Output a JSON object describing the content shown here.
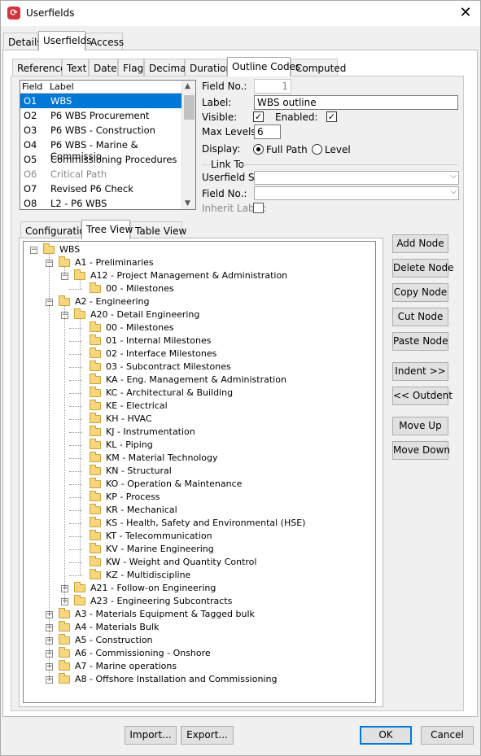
{
  "window": {
    "title": "Userfields",
    "close_glyph": "✕"
  },
  "top_tabs": [
    {
      "label": "Details"
    },
    {
      "label": "Userfields"
    },
    {
      "label": "Access"
    }
  ],
  "inner_tabs": [
    {
      "label": "Reference"
    },
    {
      "label": "Text"
    },
    {
      "label": "Date"
    },
    {
      "label": "Flag"
    },
    {
      "label": "Decimal"
    },
    {
      "label": "Duration"
    },
    {
      "label": "Outline Codes"
    },
    {
      "label": "Computed"
    }
  ],
  "field_list": {
    "headers": {
      "field": "Field",
      "label": "Label"
    },
    "rows": [
      {
        "field": "O1",
        "label": "WBS"
      },
      {
        "field": "O2",
        "label": "P6 WBS Procurement"
      },
      {
        "field": "O3",
        "label": "P6 WBS - Construction"
      },
      {
        "field": "O4",
        "label": "P6 WBS - Marine & Commissio"
      },
      {
        "field": "O5",
        "label": "Commissioning Procedures"
      },
      {
        "field": "O6",
        "label": "Critical Path"
      },
      {
        "field": "O7",
        "label": "Revised P6 Check"
      },
      {
        "field": "O8",
        "label": "L2 - P6 WBS"
      }
    ]
  },
  "props": {
    "field_no_label": "Field No.:",
    "field_no_value": "1",
    "label_label": "Label:",
    "label_value": "WBS outline",
    "visible_label": "Visible:",
    "visible_checked": "✓",
    "enabled_label": "Enabled:",
    "enabled_checked": "✓",
    "max_levels_label": "Max Levels:",
    "max_levels_value": "6",
    "display_label": "Display:",
    "full_path_label": "Full Path",
    "level_label": "Level",
    "link_to_label": "Link To",
    "userfield_set_label": "Userfield Set:",
    "field_no2_label": "Field No.:",
    "inherit_label": "Inherit Label:",
    "dropdown_glyph": "⌵"
  },
  "view_tabs": [
    {
      "label": "Configuration"
    },
    {
      "label": "Tree View"
    },
    {
      "label": "Table View"
    }
  ],
  "tree": {
    "expander_minus": "−",
    "expander_plus": "+",
    "nodes": [
      {
        "label": "WBS",
        "level": 0,
        "exp": "minus"
      },
      {
        "label": "A1 - Preliminaries",
        "level": 1,
        "exp": "minus"
      },
      {
        "label": "A12 - Project Management & Administration",
        "level": 2,
        "exp": "minus"
      },
      {
        "label": "00 - Milestones",
        "level": 3,
        "exp": ""
      },
      {
        "label": "A2 - Engineering",
        "level": 1,
        "exp": "minus"
      },
      {
        "label": "A20 - Detail Engineering",
        "level": 2,
        "exp": "minus"
      },
      {
        "label": "00 - Milestones",
        "level": 3,
        "exp": ""
      },
      {
        "label": "01 - Internal Milestones",
        "level": 3,
        "exp": ""
      },
      {
        "label": "02 - Interface Milestones",
        "level": 3,
        "exp": ""
      },
      {
        "label": "03 - Subcontract Milestones",
        "level": 3,
        "exp": ""
      },
      {
        "label": "KA - Eng. Management & Administration",
        "level": 3,
        "exp": ""
      },
      {
        "label": "KC - Architectural & Building",
        "level": 3,
        "exp": ""
      },
      {
        "label": "KE - Electrical",
        "level": 3,
        "exp": ""
      },
      {
        "label": "KH - HVAC",
        "level": 3,
        "exp": ""
      },
      {
        "label": "KJ - Instrumentation",
        "level": 3,
        "exp": ""
      },
      {
        "label": "KL - Piping",
        "level": 3,
        "exp": ""
      },
      {
        "label": "KM - Material Technology",
        "level": 3,
        "exp": ""
      },
      {
        "label": "KN - Structural",
        "level": 3,
        "exp": ""
      },
      {
        "label": "KO - Operation & Maintenance",
        "level": 3,
        "exp": ""
      },
      {
        "label": "KP - Process",
        "level": 3,
        "exp": ""
      },
      {
        "label": "KR - Mechanical",
        "level": 3,
        "exp": ""
      },
      {
        "label": "KS - Health, Safety and Environmental (HSE)",
        "level": 3,
        "exp": ""
      },
      {
        "label": "KT - Telecommunication",
        "level": 3,
        "exp": ""
      },
      {
        "label": "KV - Marine Engineering",
        "level": 3,
        "exp": ""
      },
      {
        "label": "KW - Weight and Quantity Control",
        "level": 3,
        "exp": ""
      },
      {
        "label": "KZ - Multidiscipline",
        "level": 3,
        "exp": ""
      },
      {
        "label": "A21 - Follow-on Engineering",
        "level": 2,
        "exp": "plus"
      },
      {
        "label": "A23 - Engineering Subcontracts",
        "level": 2,
        "exp": "plus"
      },
      {
        "label": "A3 - Materials Equipment & Tagged bulk",
        "level": 1,
        "exp": "plus"
      },
      {
        "label": "A4 - Materials Bulk",
        "level": 1,
        "exp": "plus"
      },
      {
        "label": "A5 - Construction",
        "level": 1,
        "exp": "plus"
      },
      {
        "label": "A6 - Commissioning - Onshore",
        "level": 1,
        "exp": "plus"
      },
      {
        "label": "A7 - Marine operations",
        "level": 1,
        "exp": "plus"
      },
      {
        "label": "A8 - Offshore Installation and Commissioning",
        "level": 1,
        "exp": "plus"
      }
    ]
  },
  "side_buttons": {
    "add_node": "Add Node",
    "delete_node": "Delete Node",
    "copy_node": "Copy Node",
    "cut_node": "Cut Node",
    "paste_node": "Paste Node",
    "indent": "Indent >>",
    "outdent": "<< Outdent",
    "move_up": "Move Up",
    "move_down": "Move Down"
  },
  "footer": {
    "import": "Import...",
    "export": "Export...",
    "ok": "OK",
    "cancel": "Cancel"
  }
}
